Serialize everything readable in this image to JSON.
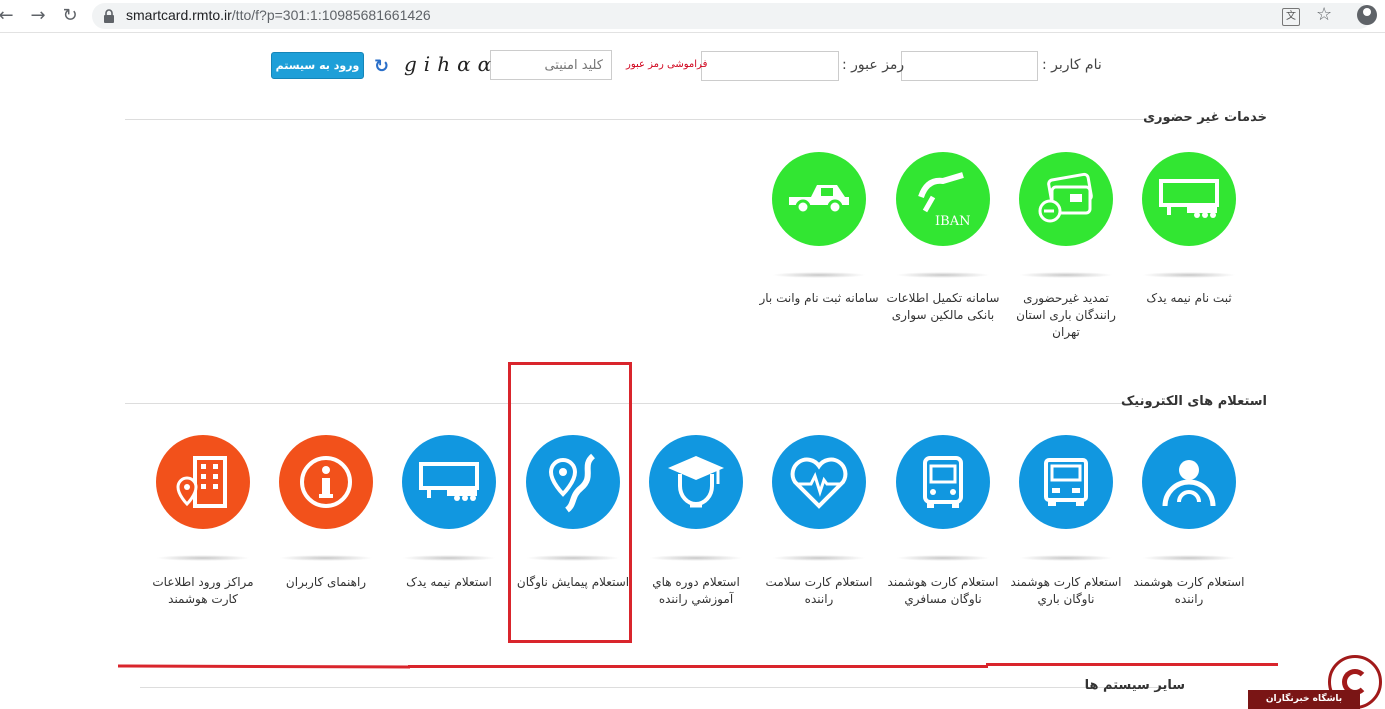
{
  "browser": {
    "url_host": "smartcard.rmto.ir",
    "url_path": "/tto/f?p=301:1:10985681661426"
  },
  "login": {
    "username_label": "نام کاربر :",
    "password_label": "رمز عبور :",
    "forgot_password": "فراموشی رمز عبور",
    "security_key_placeholder": "کلید امنیتی",
    "captcha_text": "gihαα",
    "login_button": "ورود به سیستم"
  },
  "sections": {
    "remote_services": {
      "title": "خدمات غیر حضوری",
      "tiles": [
        {
          "label": "ثبت نام نیمه یدک",
          "icon": "semi-trailer-icon",
          "color": "#32e632"
        },
        {
          "label": "تمدید غیرحضوری رانندگان باری استان تهران",
          "icon": "smart-card-renew-icon",
          "color": "#32e632"
        },
        {
          "label": "سامانه تکمیل اطلاعات بانکی مالکین سواری",
          "icon": "shaba-iban-icon",
          "color": "#32e632"
        },
        {
          "label": "سامانه ثبت نام وانت بار",
          "icon": "pickup-truck-icon",
          "color": "#32e632"
        }
      ]
    },
    "electronic_inquiries": {
      "title": "استعلام های الکترونیک",
      "tiles": [
        {
          "label": "استعلام کارت هوشمند راننده",
          "icon": "driver-icon",
          "color": "#1197e0"
        },
        {
          "label": "استعلام کارت هوشمند ناوگان باري",
          "icon": "truck-icon",
          "color": "#1197e0"
        },
        {
          "label": "استعلام کارت هوشمند ناوگان مسافري",
          "icon": "bus-icon",
          "color": "#1197e0"
        },
        {
          "label": "استعلام کارت سلامت راننده",
          "icon": "heart-health-icon",
          "color": "#1197e0"
        },
        {
          "label": "استعلام دوره هاي آموزشي راننده",
          "icon": "graduation-icon",
          "color": "#1197e0"
        },
        {
          "label": "استعلام پیمایش ناوگان",
          "icon": "route-location-icon",
          "color": "#1197e0"
        },
        {
          "label": "استعلام نیمه یدک",
          "icon": "semi-trailer-icon",
          "color": "#1197e0"
        },
        {
          "label": "راهنمای کاربران",
          "icon": "info-icon",
          "color": "#f2511b"
        },
        {
          "label": "مراکز ورود اطلاعات کارت هوشمند",
          "icon": "building-location-icon",
          "color": "#f2511b"
        }
      ]
    },
    "other_systems": {
      "title": "سایر سیستم ها"
    }
  },
  "watermark": {
    "text": "باشگاه خبرنگاران"
  }
}
